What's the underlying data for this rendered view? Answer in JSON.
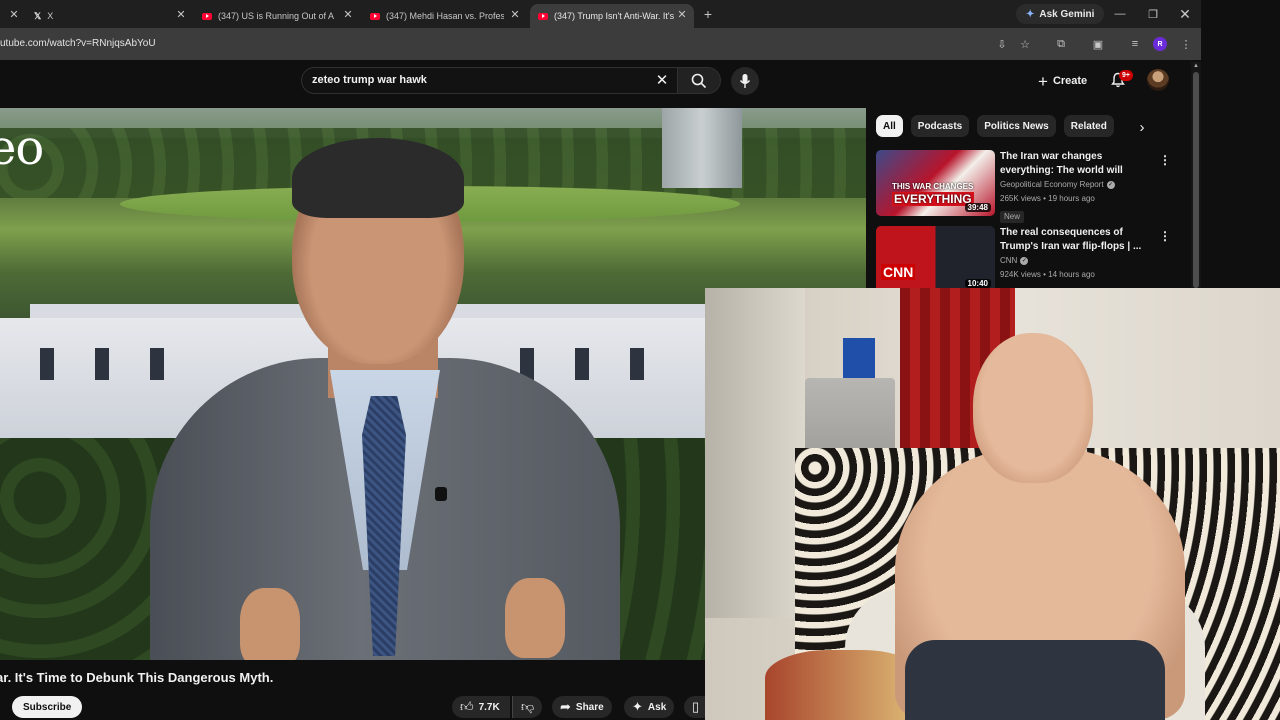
{
  "browser": {
    "tabs": [
      {
        "title": "X"
      },
      {
        "title": "(347) US is Running Out of Am"
      },
      {
        "title": "(347) Mehdi Hasan vs. Professo"
      },
      {
        "title": "(347) Trump Isn't Anti-War. It's"
      }
    ],
    "gemini_label": "Ask Gemini",
    "url": "utube.com/watch?v=RNnjqsAbYoU",
    "profile_initial": "R"
  },
  "masthead": {
    "search_query": "zeteo trump war hawk",
    "create_label": "Create",
    "notification_count": "9+"
  },
  "player": {
    "brand_text": "eo"
  },
  "chips": [
    "All",
    "Podcasts",
    "Politics News",
    "Related"
  ],
  "related": [
    {
      "title": "The Iran war changes\neverything: The world will neve...",
      "channel": "Geopolitical Economy Report",
      "meta": "265K views • 19 hours ago",
      "badge": "New",
      "duration": "39:48",
      "thumb_caption_1": "THIS WAR CHANGES",
      "thumb_caption_2": "EVERYTHING"
    },
    {
      "title": "The real consequences of\nTrump's Iran war flip-flops | ...",
      "channel": "CNN",
      "meta": "924K views • 14 hours ago",
      "duration": "10:40",
      "thumb_logo": "CNN"
    }
  ],
  "video": {
    "title": "ar. It's Time to Debunk This Dangerous Myth.",
    "subscribe_label": "Subscribe",
    "like_count": "7.7K",
    "share_label": "Share",
    "ask_label": "Ask"
  },
  "colors": {
    "background": "#0f0f0f",
    "accent_red": "#ff0033",
    "chip_active": "#f1f1f1"
  }
}
